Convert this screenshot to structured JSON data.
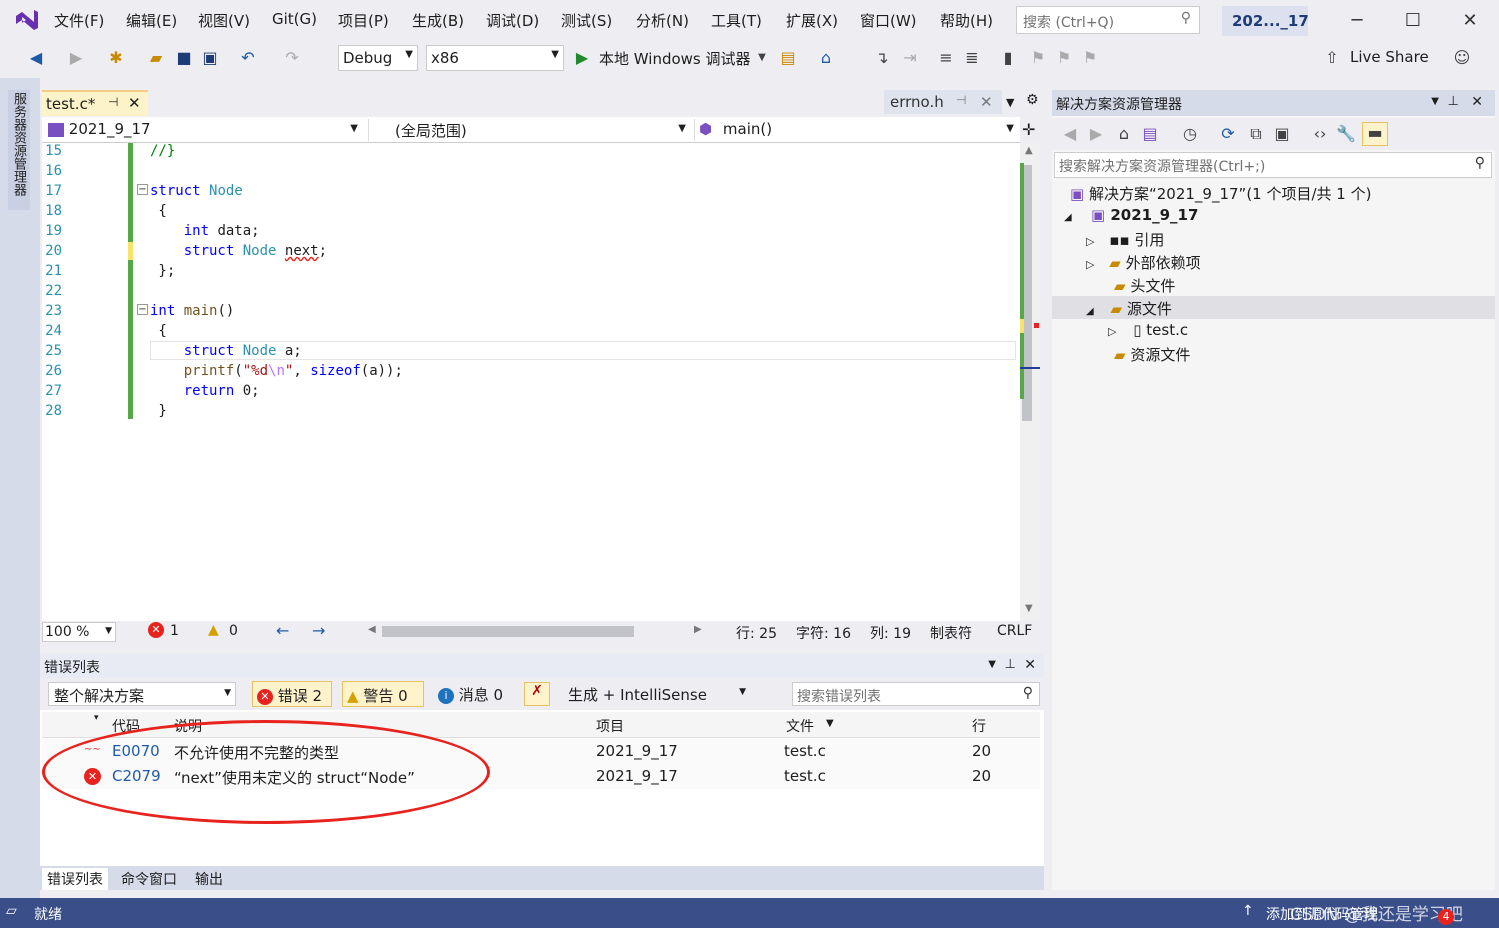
{
  "menubar": {
    "items": [
      "文件(F)",
      "编辑(E)",
      "视图(V)",
      "Git(G)",
      "项目(P)",
      "生成(B)",
      "调试(D)",
      "测试(S)",
      "分析(N)",
      "工具(T)",
      "扩展(X)",
      "窗口(W)",
      "帮助(H)"
    ],
    "search_placeholder": "搜索 (Ctrl+Q)",
    "title": "202..._17",
    "minimize": "─",
    "maximize": "☐",
    "close": "✕"
  },
  "toolbar": {
    "config": "Debug",
    "platform": "x86",
    "debugger": "本地 Windows 调试器",
    "live_share": "Live Share"
  },
  "left_strip": {
    "vertical_tab": "服务器资源管理器"
  },
  "editor": {
    "tab_active": "test.c*",
    "tab_pin": "⊣",
    "tab_close": "✕",
    "tab_other": "errno.h",
    "nav_project": "2021_9_17",
    "nav_scope": "(全局范围)",
    "nav_member": "main()",
    "line_numbers": [
      "15",
      "16",
      "17",
      "18",
      "19",
      "20",
      "21",
      "22",
      "23",
      "24",
      "25",
      "26",
      "27",
      "28"
    ],
    "lines": [
      "//}",
      "",
      "struct Node",
      " {",
      "     int data;",
      "     struct Node next;",
      " };",
      "",
      "int main()",
      " {",
      "     struct Node a;",
      "     printf(\"%d\\n\", sizeof(a));",
      "     return 0;",
      " }"
    ]
  },
  "status_line": {
    "zoom": "100 %",
    "errors": "1",
    "warnings": "0",
    "line": "行: 25",
    "char": "字符: 16",
    "col": "列: 19",
    "tabs": "制表符",
    "eol": "CRLF"
  },
  "error_list": {
    "title": "错误列表",
    "scope": "整个解决方案",
    "errors_btn": "错误 2",
    "warnings_btn": "警告 0",
    "messages_btn": "消息 0",
    "build_filter": "生成 + IntelliSense",
    "search_placeholder": "搜索错误列表",
    "columns": [
      "代码",
      "说明",
      "项目",
      "文件",
      "行"
    ],
    "rows": [
      {
        "code": "E0070",
        "desc": "不允许使用不完整的类型",
        "project": "2021_9_17",
        "file": "test.c",
        "line": "20"
      },
      {
        "code": "C2079",
        "desc": "“next”使用未定义的 struct“Node”",
        "project": "2021_9_17",
        "file": "test.c",
        "line": "20"
      }
    ]
  },
  "bottom_tabs": [
    "错误列表",
    "命令窗口",
    "输出"
  ],
  "solution_explorer": {
    "title": "解决方案资源管理器",
    "search_placeholder": "搜索解决方案资源管理器(Ctrl+;)",
    "tree": [
      {
        "label": "解决方案“2021_9_17”(1 个项目/共 1 个)"
      },
      {
        "label": "2021_9_17"
      },
      {
        "label": "引用"
      },
      {
        "label": "外部依赖项"
      },
      {
        "label": "头文件"
      },
      {
        "label": "源文件"
      },
      {
        "label": "test.c"
      },
      {
        "label": "资源文件"
      }
    ]
  },
  "statusbar": {
    "ready": "就绪",
    "add_source": "添加到源代码管理",
    "watermark": "CSDN @我还是学习吧",
    "badge": "4"
  }
}
